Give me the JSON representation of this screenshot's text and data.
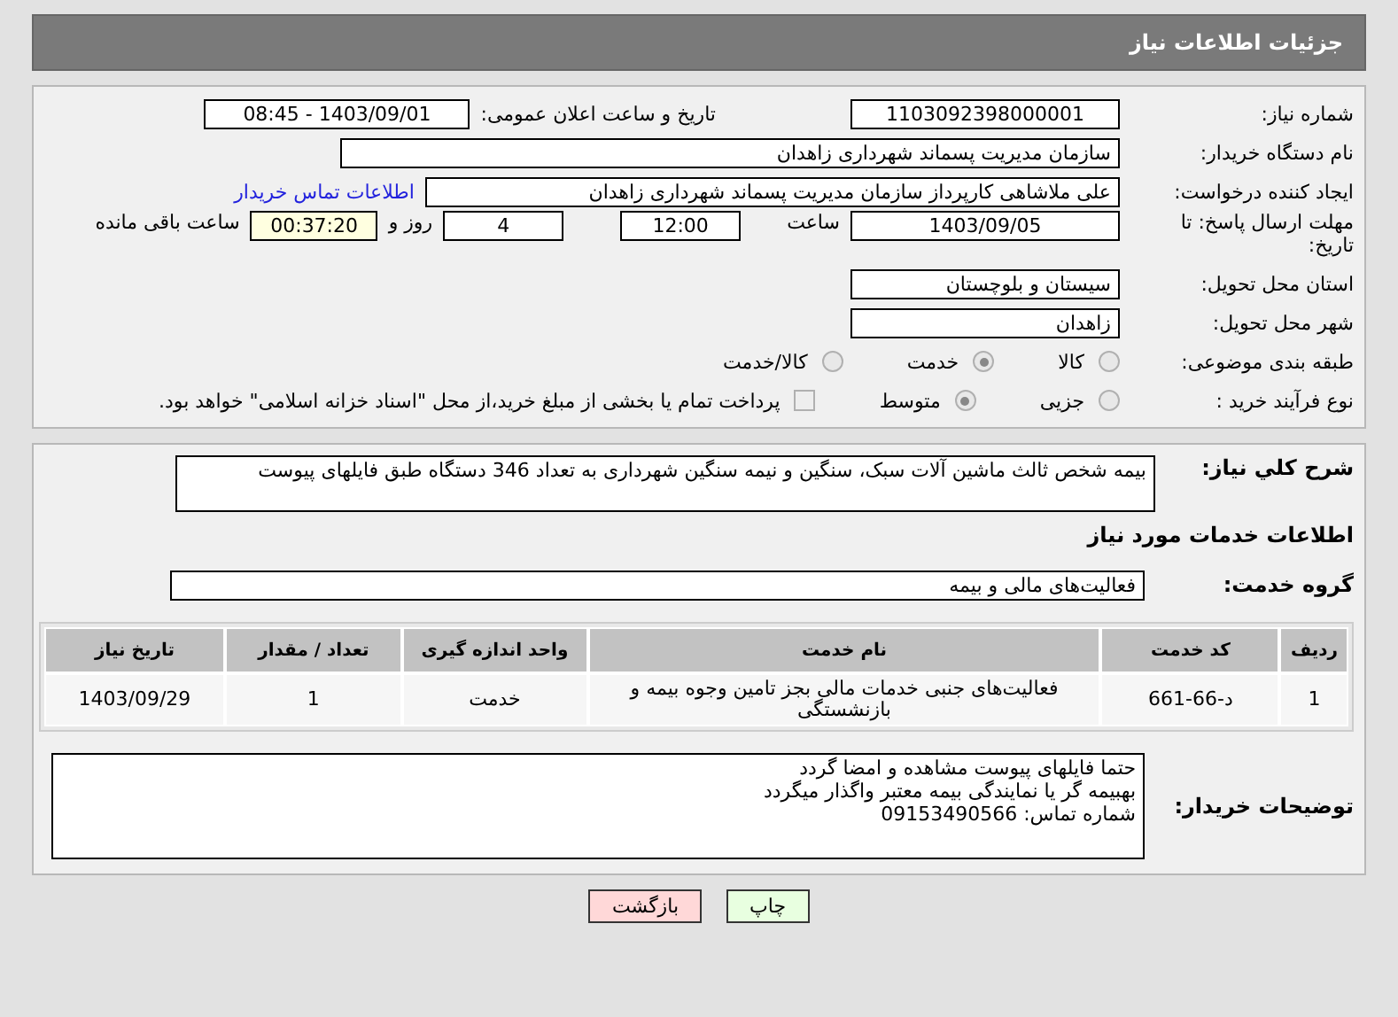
{
  "header": {
    "title": "جزئیات اطلاعات نیاز"
  },
  "details": {
    "need_number": {
      "label": "شماره نیاز:",
      "value": "1103092398000001"
    },
    "announce": {
      "label": "تاریخ و ساعت اعلان عمومی:",
      "value": "1403/09/01 - 08:45"
    },
    "buyer_org": {
      "label": "نام دستگاه خریدار:",
      "value": "سازمان مدیریت پسماند شهرداری زاهدان"
    },
    "requester": {
      "label": "ایجاد کننده درخواست:",
      "value": "علی ملاشاهی کارپرداز سازمان مدیریت پسماند شهرداری زاهدان",
      "link": "اطلاعات تماس خریدار"
    },
    "deadline": {
      "label": "مهلت ارسال پاسخ: تا تاریخ:",
      "date": "1403/09/05",
      "time_label": "ساعت",
      "time": "12:00",
      "days": "4",
      "days_label": "روز و",
      "remaining": "00:37:20",
      "remaining_label": "ساعت باقی مانده"
    },
    "province": {
      "label": "استان محل تحویل:",
      "value": "سیستان و بلوچستان"
    },
    "city": {
      "label": "شهر محل تحویل:",
      "value": "زاهدان"
    },
    "category": {
      "label": "طبقه بندی موضوعی:",
      "options": [
        {
          "label": "کالا",
          "selected": false
        },
        {
          "label": "خدمت",
          "selected": true
        },
        {
          "label": "کالا/خدمت",
          "selected": false
        }
      ]
    },
    "process": {
      "label": "نوع فرآیند خرید :",
      "options": [
        {
          "label": "جزیی",
          "selected": false
        },
        {
          "label": "متوسط",
          "selected": true
        }
      ],
      "payment": {
        "label": "پرداخت تمام یا بخشی از مبلغ خرید،از محل \"اسناد خزانه اسلامی\" خواهد بود.",
        "checked": false
      }
    }
  },
  "description": {
    "label": "شرح کلي نياز:",
    "value": "بیمه شخص ثالث ماشین آلات سبک، سنگین و نیمه سنگین شهرداری به تعداد 346 دستگاه طبق فایلهای پیوست"
  },
  "services_heading": "اطلاعات خدمات مورد نیاز",
  "service_group": {
    "label": "گروه خدمت:",
    "value": "فعالیت‌های مالی و بیمه"
  },
  "table": {
    "columns": [
      "ردیف",
      "کد خدمت",
      "نام خدمت",
      "واحد اندازه گیری",
      "تعداد / مقدار",
      "تاریخ نیاز"
    ],
    "rows": [
      [
        "1",
        "د-66-661",
        "فعالیت‌های جنبی خدمات مالی بجز تامین وجوه بیمه و بازنشستگی",
        "خدمت",
        "1",
        "1403/09/29"
      ]
    ]
  },
  "buyer_notes": {
    "label": "توضیحات خریدار:",
    "lines": [
      "حتما فایلهای پیوست مشاهده و امضا گردد",
      "بهبیمه گر یا نمایندگی بیمه معتبر واگذار میگردد",
      "شماره تماس: 09153490566"
    ]
  },
  "buttons": [
    {
      "label": "چاپ",
      "kind": "print"
    },
    {
      "label": "بازگشت",
      "kind": "back"
    }
  ]
}
